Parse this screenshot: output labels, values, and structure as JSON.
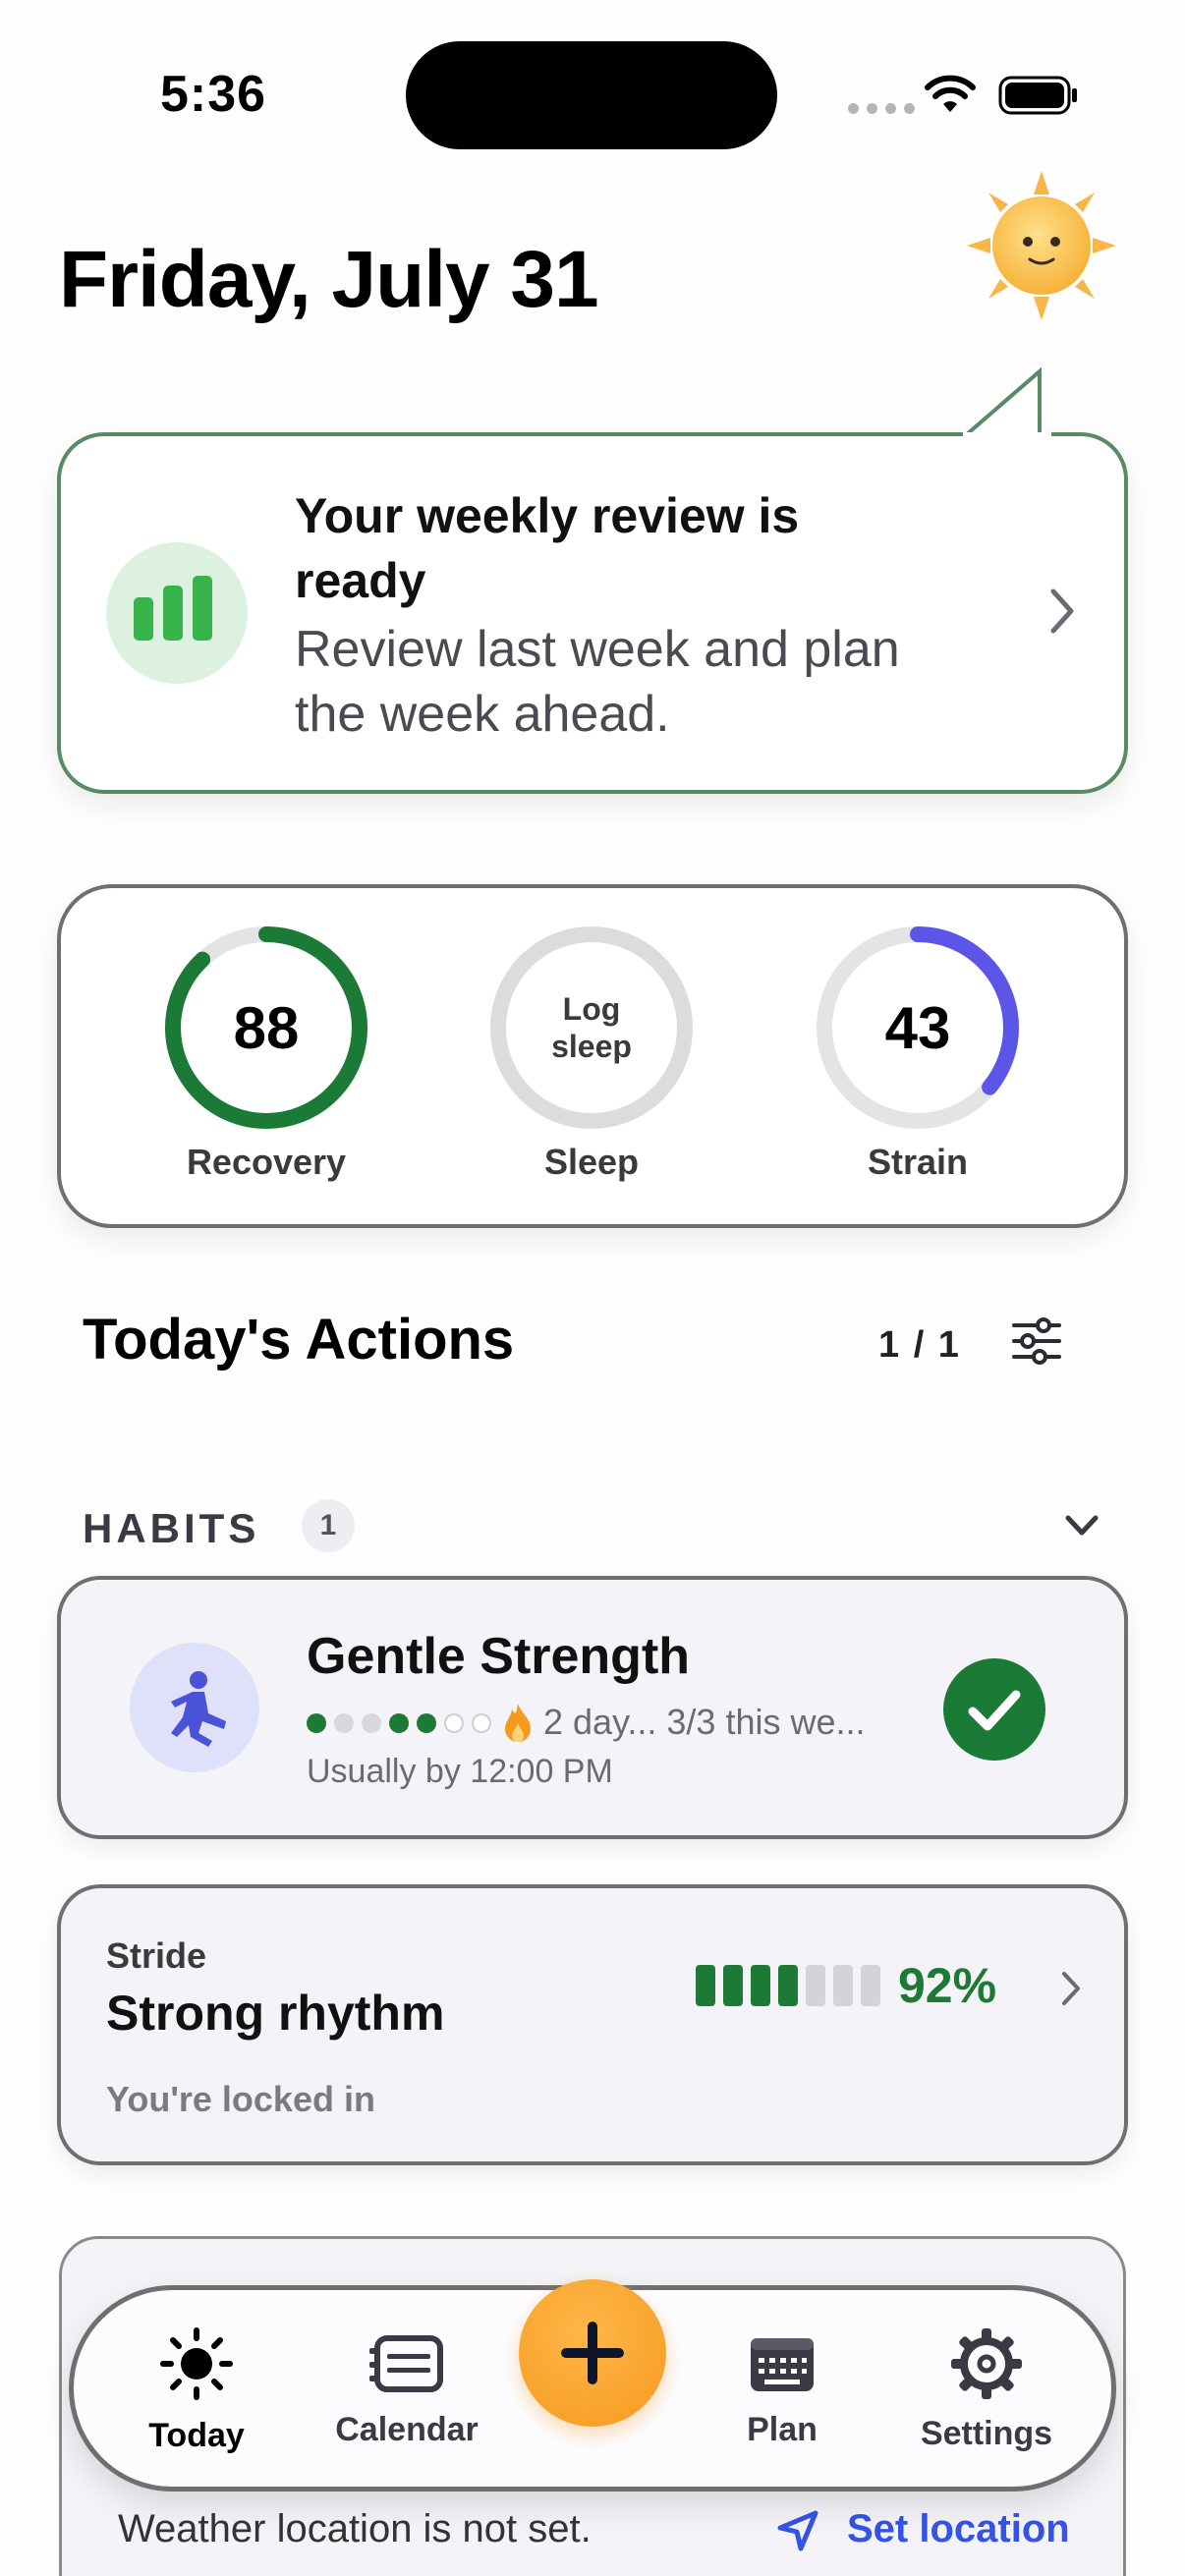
{
  "status_bar": {
    "time": "5:36"
  },
  "header": {
    "date": "Friday, July 31"
  },
  "review_card": {
    "title": "Your weekly review is ready",
    "subtitle": "Review last week and plan the week ahead."
  },
  "metrics": {
    "recovery": {
      "value": "88",
      "label": "Recovery",
      "progress": 0.88,
      "color": "#1a7a36"
    },
    "sleep": {
      "prompt_line1": "Log",
      "prompt_line2": "sleep",
      "label": "Sleep"
    },
    "strain": {
      "value": "43",
      "label": "Strain",
      "progress": 0.36,
      "color": "#5b55e8"
    }
  },
  "actions": {
    "title": "Today's Actions",
    "count": "1 / 1"
  },
  "habits": {
    "section_label": "HABITS",
    "count": "1",
    "items": [
      {
        "name": "Gentle Strength",
        "streak_text": "2 day...  3/3 this we...",
        "usually": "Usually by 12:00 PM",
        "completed": true
      }
    ]
  },
  "stride": {
    "label": "Stride",
    "title": "Strong rhythm",
    "subtitle": "You're locked in",
    "percent": "92%",
    "bars_filled": 4,
    "bars_total": 7
  },
  "weather": {
    "message": "Weather location is not set.",
    "action": "Set location"
  },
  "tab_bar": {
    "items": [
      {
        "label": "Today",
        "icon": "sun-icon",
        "active": true
      },
      {
        "label": "Calendar",
        "icon": "calendar-icon",
        "active": false
      },
      {
        "label": "Plan",
        "icon": "keyboard-icon",
        "active": false
      },
      {
        "label": "Settings",
        "icon": "gear-icon",
        "active": false
      }
    ],
    "add_icon": "plus-icon"
  },
  "colors": {
    "accent_green": "#1a7a36",
    "accent_orange": "#f59a1f",
    "accent_blue": "#3553e6",
    "strain_purple": "#5b55e8"
  }
}
